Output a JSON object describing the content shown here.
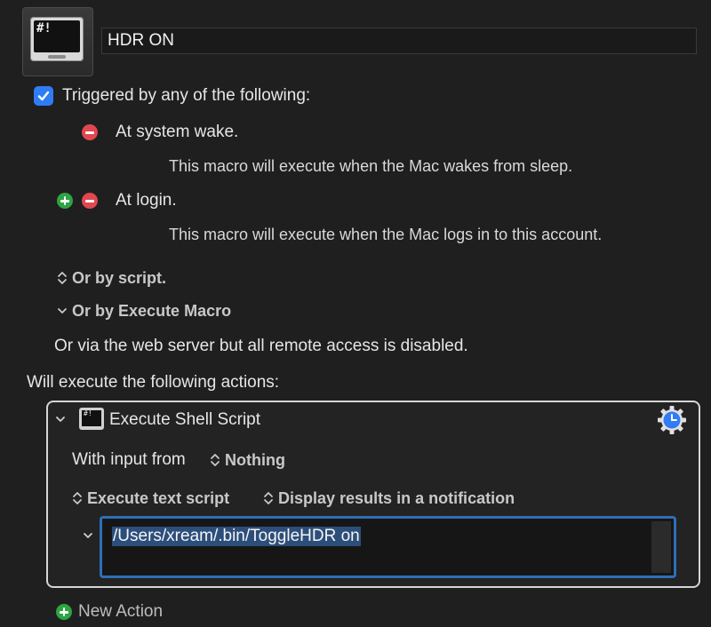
{
  "macro": {
    "icon": "terminal-icon",
    "icon_text": "#!",
    "name": "HDR ON"
  },
  "triggers": {
    "checkbox_checked": true,
    "heading": "Triggered by any of the following:",
    "items": [
      {
        "title": "At system wake.",
        "description": "This macro will execute when the Mac wakes from sleep."
      },
      {
        "title": "At login.",
        "description": "This macro will execute when the Mac logs in to this account."
      }
    ],
    "by_script": "Or by script.",
    "by_execute_macro": "Or by Execute Macro",
    "web_server": "Or via the web server but all remote access is disabled."
  },
  "actions": {
    "heading": "Will execute the following actions:",
    "action": {
      "title": "Execute Shell Script",
      "icon_text": "#!",
      "input_label": "With input from",
      "input_value": "Nothing",
      "mode": "Execute text script",
      "output": "Display results in a notification",
      "script": "/Users/xream/.bin/ToggleHDR on"
    },
    "new_action": "New Action"
  },
  "colors": {
    "accent_blue": "#2f7cf6",
    "remove_red": "#e0484f",
    "add_green": "#2ea443",
    "selection": "#2c4e7a"
  }
}
